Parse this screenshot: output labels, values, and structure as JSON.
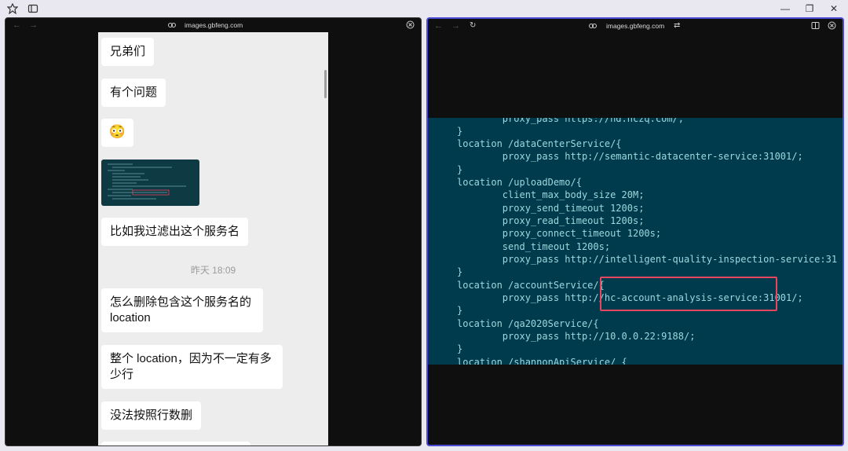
{
  "window": {
    "controls": {
      "minimize": "—",
      "maximize": "❐",
      "close": "✕"
    }
  },
  "left_pane": {
    "url": "images.gbfeng.com",
    "chat": {
      "messages": [
        {
          "type": "text",
          "text": "兄弟们"
        },
        {
          "type": "text",
          "text": "有个问题"
        },
        {
          "type": "emoji",
          "icon": "flushed-face-icon",
          "text": "😳"
        },
        {
          "type": "image"
        },
        {
          "type": "text",
          "text": "比如我过滤出这个服务名"
        },
        {
          "type": "timestamp",
          "text": "昨天 18:09"
        },
        {
          "type": "text",
          "text": "怎么删除包含这个服务名的location"
        },
        {
          "type": "text",
          "text": "整个 location，因为不一定有多少行"
        },
        {
          "type": "text",
          "text": "没法按照行数删"
        }
      ]
    }
  },
  "right_pane": {
    "url": "images.gbfeng.com",
    "code_lines": [
      "        proxy_pass https://hd.hczq.com/;",
      "}",
      "location /dataCenterService/{",
      "        proxy_pass http://semantic-datacenter-service:31001/;",
      "}",
      "location /uploadDemo/{",
      "        client_max_body_size 20M;",
      "        proxy_send_timeout 1200s;",
      "        proxy_read_timeout 1200s;",
      "        proxy_connect_timeout 1200s;",
      "        send_timeout 1200s;",
      "        proxy_pass http://intelligent-quality-inspection-service:31",
      "}",
      "location /accountService/{",
      "        proxy_pass http://hc-account-analysis-service:31001/;",
      "}",
      "location /qa2020Service/{",
      "        proxy_pass http://10.0.0.22:9188/;",
      "}",
      "location /shannonApiService/ {"
    ],
    "highlight_color": "#e6465e",
    "code_bg": "#003b4d"
  }
}
